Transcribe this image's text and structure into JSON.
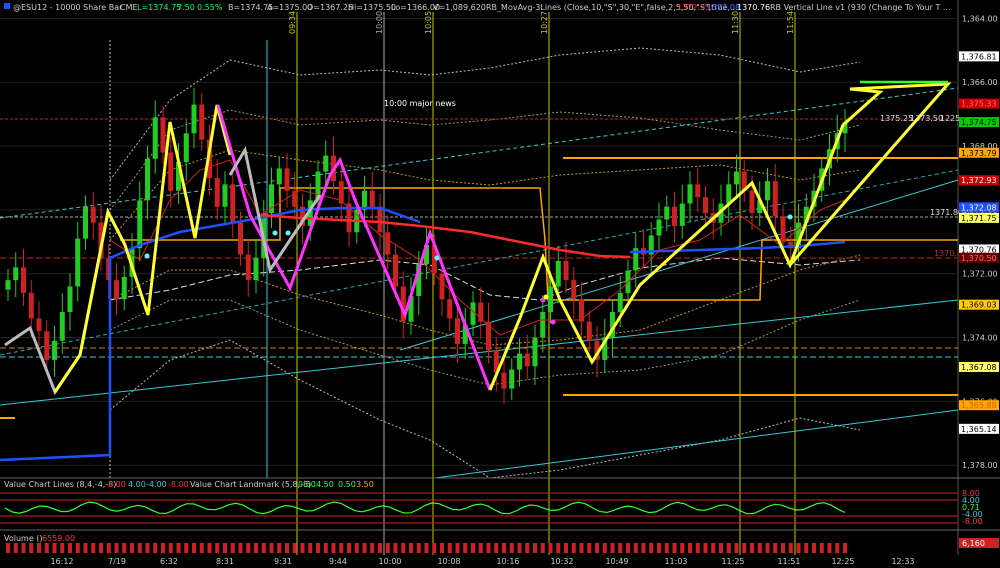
{
  "header": {
    "symbol": "@ESU12 - 10000 Share Bar",
    "exchange": "CME",
    "last": "L=1374.75",
    "change": "7.50",
    "pct": "0.55%",
    "bid": "B=1374.75",
    "ask": "A=1375.00",
    "open": "O=1367.25",
    "high": "Hi=1375.50",
    "low": "Lo=1366.00",
    "volume": "V=1,089,620",
    "study1": "RB_MovAvg-3Lines (Close,10,\"S\",30,\"E\",false,2,5,50,\"S\",true,...",
    "study1_v1": "1372.93",
    "study1_v2": "1372.08",
    "study1_v3": "1370.76",
    "study2": "RB Vertical Line v1 (930 (Change To Your T ..."
  },
  "annotations": {
    "major_news": "10:00 major news",
    "ann_1": "1375.25",
    "ann_2": "1373.50",
    "ann_3": "1225",
    "ann_4": "1371.80",
    "ann_5": "1370.5"
  },
  "price_axis": {
    "labels": [
      "1,378.00",
      "1,376.00",
      "1,374.00",
      "1,372.00",
      "1,370.00",
      "1,368.00",
      "1,366.00",
      "1,364.00"
    ],
    "badges": [
      {
        "text": "1,376.81",
        "bg": "#ffffff",
        "fg": "#000000"
      },
      {
        "text": "1,375.33",
        "bg": "#cc0000",
        "fg": "#ff6666"
      },
      {
        "text": "1,374.75",
        "bg": "#00cc00",
        "fg": "#000000"
      },
      {
        "text": "1,373.79",
        "bg": "#ffa500",
        "fg": "#000000"
      },
      {
        "text": "1,372.93",
        "bg": "#cc0000",
        "fg": "#ffffff"
      },
      {
        "text": "1,372.08",
        "bg": "#1e50ff",
        "fg": "#ffffff"
      },
      {
        "text": "1,371.75",
        "bg": "#ffff66",
        "fg": "#000000"
      },
      {
        "text": "1,370.76",
        "bg": "#ffffff",
        "fg": "#000000"
      },
      {
        "text": "1,370.50",
        "bg": "#660000",
        "fg": "#ff6666"
      },
      {
        "text": "1,369.03",
        "bg": "#ffcc00",
        "fg": "#000000"
      },
      {
        "text": "1,367.08",
        "bg": "#ffff66",
        "fg": "#000000"
      },
      {
        "text": "1,365.88",
        "bg": "#ffa500",
        "fg": "#cc6600"
      },
      {
        "text": "1,365.14",
        "bg": "#ffffff",
        "fg": "#000000"
      }
    ]
  },
  "vlines": [
    "09:34",
    "10:00",
    "10:05",
    "10:27",
    "11:30",
    "11:54"
  ],
  "indicator1": {
    "title": "Value Chart Lines (8,4,-4,-8)",
    "v1": "8.00",
    "v2": "4.00",
    "v3": "-4.00",
    "v4": "-8.00",
    "title2": "Value Chart Landmark (5,8,-8)",
    "v5": "0.50",
    "v6": "4.50",
    "v7": "0.50",
    "v8": "3.50",
    "axis": [
      "8.00",
      "4.00",
      "0.71",
      "-4.00",
      "-8.00"
    ]
  },
  "indicator2": {
    "title": "Volume ()",
    "value": "6559.00",
    "axis": [
      "6,160"
    ]
  },
  "time_axis": [
    "16:12",
    "7/19",
    "6:32",
    "8:31",
    "9:31",
    "9:44",
    "10:00",
    "10:08",
    "10:16",
    "10:32",
    "10:49",
    "11:03",
    "11:25",
    "11:51",
    "12:25",
    "12:33"
  ],
  "chart_data": {
    "type": "candlestick",
    "symbol": "@ESU12",
    "ylim": [
      1363.6,
      1378.2
    ],
    "yticks": [
      1364,
      1366,
      1368,
      1370,
      1372,
      1374,
      1376,
      1378
    ],
    "closes": [
      1369.8,
      1370.2,
      1369.4,
      1368.6,
      1368.2,
      1367.3,
      1367.9,
      1368.8,
      1369.6,
      1371.1,
      1372.1,
      1371.6,
      1370.5,
      1369.8,
      1369.2,
      1369.9,
      1370.8,
      1372.3,
      1373.6,
      1374.9,
      1373.8,
      1372.6,
      1373.5,
      1374.4,
      1375.3,
      1374.2,
      1373.0,
      1372.1,
      1372.8,
      1371.6,
      1370.6,
      1369.8,
      1370.5,
      1371.9,
      1372.8,
      1373.3,
      1372.6,
      1372.1,
      1371.5,
      1372.3,
      1373.2,
      1373.7,
      1372.9,
      1372.2,
      1371.3,
      1372.0,
      1372.6,
      1372.1,
      1371.3,
      1370.6,
      1369.6,
      1368.5,
      1369.3,
      1370.3,
      1370.9,
      1370.0,
      1369.2,
      1368.6,
      1367.8,
      1368.4,
      1369.1,
      1368.5,
      1367.6,
      1366.9,
      1366.4,
      1367.0,
      1367.5,
      1367.1,
      1368.0,
      1368.8,
      1369.6,
      1370.4,
      1369.8,
      1369.2,
      1368.5,
      1367.9,
      1367.3,
      1368.0,
      1368.8,
      1369.4,
      1370.1,
      1370.8,
      1370.6,
      1371.2,
      1371.7,
      1372.1,
      1371.5,
      1372.2,
      1372.8,
      1372.4,
      1371.9,
      1371.6,
      1372.2,
      1372.8,
      1373.2,
      1372.6,
      1371.9,
      1372.3,
      1372.9,
      1371.8,
      1371.0,
      1370.8,
      1371.6,
      1372.1,
      1372.6,
      1373.3,
      1373.9,
      1374.4,
      1374.75
    ],
    "series": [
      {
        "name": "MA 10 S",
        "value": "1372.93",
        "color": "#ff2a2a"
      },
      {
        "name": "MA 30 E",
        "value": "1372.08",
        "color": "#2a5aff"
      },
      {
        "name": "MA 50 S",
        "value": "1370.76",
        "color": "#ffffff"
      }
    ],
    "levels": [
      1376.81,
      1375.33,
      1374.75,
      1373.79,
      1372.93,
      1372.08,
      1371.75,
      1370.76,
      1370.5,
      1369.03,
      1367.08,
      1365.88,
      1365.14
    ]
  }
}
